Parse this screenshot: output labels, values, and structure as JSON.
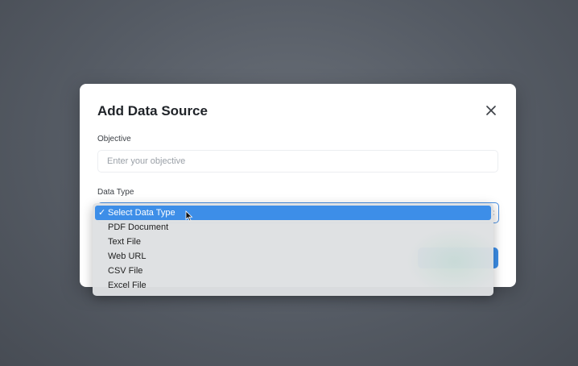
{
  "modal": {
    "title": "Add Data Source",
    "objective_label": "Objective",
    "objective_placeholder": "Enter your objective",
    "objective_value": "",
    "data_type_label": "Data Type"
  },
  "dropdown": {
    "selected_check": "✓",
    "options": [
      {
        "label": "Select Data Type",
        "selected": true
      },
      {
        "label": "PDF Document",
        "selected": false
      },
      {
        "label": "Text File",
        "selected": false
      },
      {
        "label": "Web URL",
        "selected": false
      },
      {
        "label": "CSV File",
        "selected": false
      },
      {
        "label": "Excel File",
        "selected": false
      }
    ]
  },
  "icons": {
    "close": "close-icon",
    "chevron": "chevron-updown-icon",
    "cursor": "mouse-pointer-icon",
    "check": "checkmark-icon"
  },
  "colors": {
    "accent": "#3d8ee8",
    "select_border": "#4a90e2"
  }
}
